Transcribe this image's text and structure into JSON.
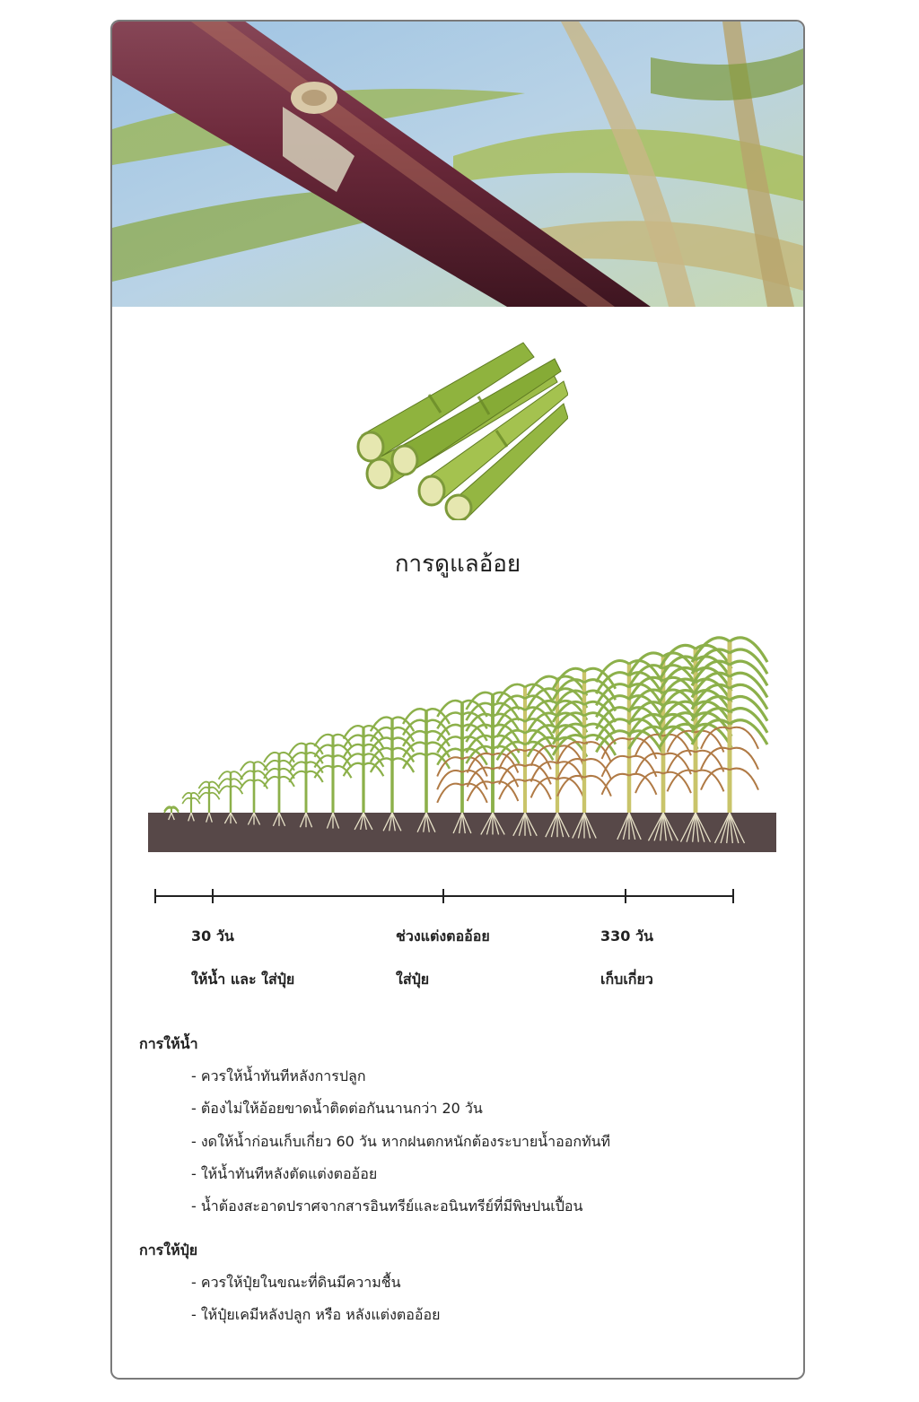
{
  "title": "การดูแลอ้อย",
  "timeline": {
    "points": [
      {
        "top": "30 วัน",
        "bottom": "ให้น้ำ และ ใส่ปุ๋ย"
      },
      {
        "top": "ช่วงแต่งตออ้อย",
        "bottom": "ใส่ปุ๋ย"
      },
      {
        "top": "330 วัน",
        "bottom": "เก็บเกี่ยว"
      }
    ]
  },
  "watering": {
    "heading": "การให้น้ำ",
    "items": [
      "- ควรให้น้ำทันทีหลังการปลูก",
      "- ต้องไม่ให้อ้อยขาดน้ำติดต่อกันนานกว่า 20 วัน",
      "- งดให้น้ำก่อนเก็บเกี่ยว 60 วัน หากฝนตกหนักต้องระบายน้ำออกทันที",
      "- ให้น้ำทันทีหลังตัดแต่งตออ้อย",
      "- น้ำต้องสะอาดปราศจากสารอินทรีย์และอนินทรีย์ที่มีพิษปนเปื้อน"
    ]
  },
  "fertilizer": {
    "heading": "การให้ปุ๋ย",
    "items": [
      "- ควรให้ปุ๋ยในขณะที่ดินมีความชื้น",
      "- ให้ปุ๋ยเคมีหลังปลูก หรือ หลังแต่งตออ้อย"
    ]
  },
  "colors": {
    "soil": "#574848",
    "stem_green": "#8cb04a",
    "dry_leaf": "#b07a45",
    "cane_purple": "#6b2a3a"
  }
}
